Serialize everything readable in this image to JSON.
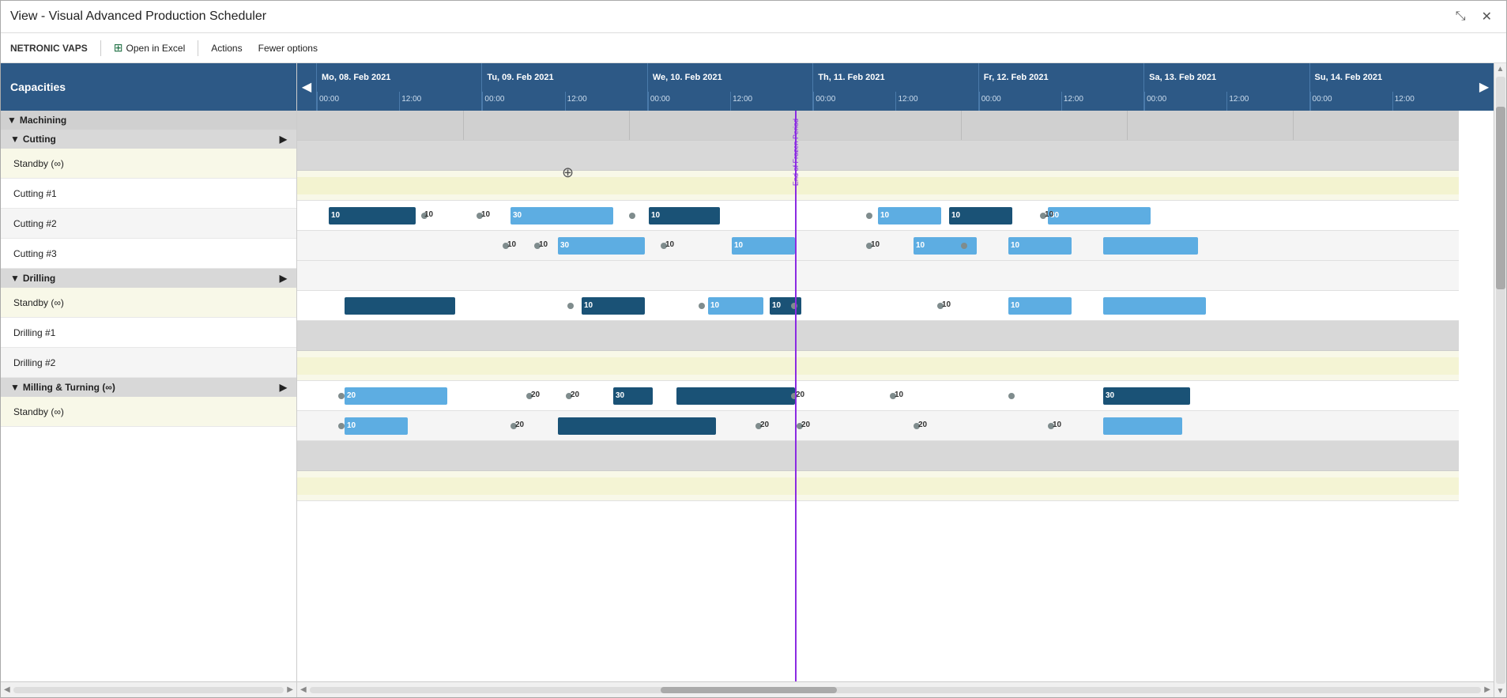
{
  "window": {
    "title": "View - Visual Advanced Production Scheduler",
    "minimize_label": "⤡",
    "close_label": "✕"
  },
  "toolbar": {
    "brand": "NETRONIC VAPS",
    "excel_btn": "Open in Excel",
    "actions_btn": "Actions",
    "options_btn": "Fewer options"
  },
  "left": {
    "header": "Capacities",
    "groups": [
      {
        "name": "Machining",
        "expanded": true,
        "subgroups": [
          {
            "name": "Cutting",
            "expanded": true,
            "rows": [
              {
                "label": "Standby (∞)",
                "type": "standby"
              },
              {
                "label": "Cutting #1",
                "type": "normal"
              },
              {
                "label": "Cutting #2",
                "type": "normal"
              },
              {
                "label": "Cutting #3",
                "type": "normal"
              }
            ]
          },
          {
            "name": "Drilling",
            "expanded": true,
            "rows": [
              {
                "label": "Standby (∞)",
                "type": "standby"
              },
              {
                "label": "Drilling #1",
                "type": "normal"
              },
              {
                "label": "Drilling #2",
                "type": "normal"
              }
            ]
          },
          {
            "name": "Milling & Turning (∞)",
            "expanded": true,
            "rows": [
              {
                "label": "Standby (∞)",
                "type": "standby"
              }
            ]
          }
        ]
      }
    ]
  },
  "timeline": {
    "days": [
      {
        "label": "Mo, 08. Feb 2021",
        "hours": [
          "00:00",
          "12:00"
        ]
      },
      {
        "label": "Tu, 09. Feb 2021",
        "hours": [
          "00:00",
          "12:00"
        ]
      },
      {
        "label": "We, 10. Feb 2021",
        "hours": [
          "00:00",
          "12:00"
        ]
      },
      {
        "label": "Th, 11. Feb 2021",
        "hours": [
          "00:00",
          "12:00"
        ]
      },
      {
        "label": "Fr, 12. Feb 2021",
        "hours": [
          "00:00",
          "12:00"
        ]
      },
      {
        "label": "Sa, 13. Feb 2021",
        "hours": [
          "00:00",
          "12:00"
        ]
      },
      {
        "label": "Su, 14. Feb 2021",
        "hours": [
          "00:00",
          "12:00"
        ]
      }
    ],
    "frozen_period_label": "End of Frozen Period"
  },
  "colors": {
    "header_bg": "#2d5986",
    "group_bg": "#d0d0d0",
    "standby_bg": "#f8f8e8",
    "dark_bar": "#1a5276",
    "light_bar": "#5dade2",
    "frozen_line": "#8b2be2"
  }
}
